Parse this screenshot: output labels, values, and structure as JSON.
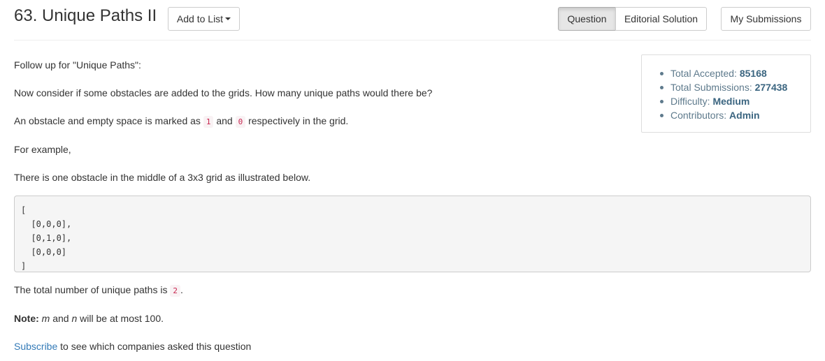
{
  "header": {
    "title": "63. Unique Paths II",
    "add_to_list_label": "Add to List",
    "tabs": [
      {
        "label": "Question",
        "active": true
      },
      {
        "label": "Editorial Solution",
        "active": false
      }
    ],
    "my_submissions_label": "My Submissions"
  },
  "stats": {
    "items": [
      {
        "label": "Total Accepted:",
        "value": "85168"
      },
      {
        "label": "Total Submissions:",
        "value": "277438"
      },
      {
        "label": "Difficulty:",
        "value": "Medium"
      },
      {
        "label": "Contributors:",
        "value": "Admin"
      }
    ]
  },
  "description": {
    "p1": "Follow up for \"Unique Paths\":",
    "p2": "Now consider if some obstacles are added to the grids. How many unique paths would there be?",
    "p3_before": "An obstacle and empty space is marked as",
    "p3_code1": "1",
    "p3_middle": "and",
    "p3_code2": "0",
    "p3_after": "respectively in the grid.",
    "p4": "For example,",
    "p5": "There is one obstacle in the middle of a 3x3 grid as illustrated below.",
    "code_lines": [
      "[",
      "  [0,0,0],",
      "  [0,1,0],",
      "  [0,0,0]",
      "]"
    ],
    "p6_before": "The total number of unique paths is",
    "p6_code": "2",
    "p6_after": ".",
    "note_label": "Note:",
    "note_m": "m",
    "note_and": "and",
    "note_n": "n",
    "note_rest": "will be at most 100.",
    "subscribe_link": "Subscribe",
    "subscribe_rest": "to see which companies asked this question"
  },
  "colors": {
    "link": "#337ab7",
    "stat_value": "#3b6580",
    "inline_code": "#c7254e",
    "code_bg": "#f5f5f5"
  }
}
